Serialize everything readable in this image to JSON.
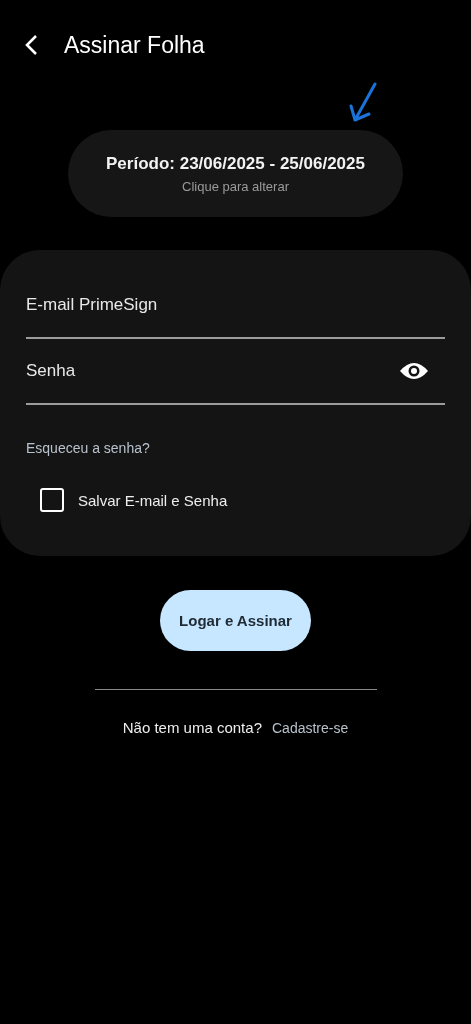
{
  "header": {
    "title": "Assinar Folha"
  },
  "period": {
    "label": "Período: 23/06/2025 - 25/06/2025",
    "hint": "Clique para alterar"
  },
  "form": {
    "email": {
      "placeholder": "E-mail PrimeSign"
    },
    "password": {
      "placeholder": "Senha"
    },
    "forgot": "Esqueceu a senha?",
    "remember": {
      "label": "Salvar E-mail e Senha",
      "checked": false
    }
  },
  "submit": "Logar e Assinar",
  "footer": {
    "question": "Não tem uma conta?",
    "link": "Cadastre-se"
  }
}
